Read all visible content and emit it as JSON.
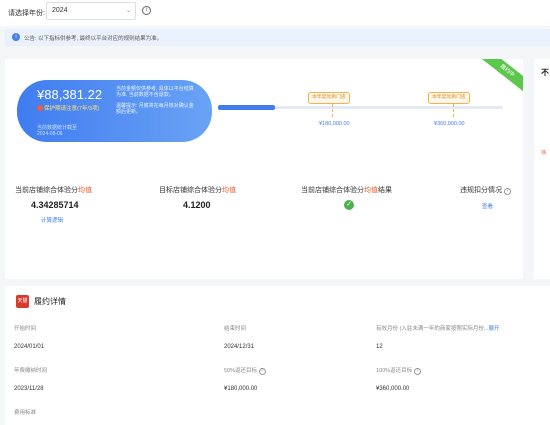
{
  "year_filter": {
    "label": "请选择年份:",
    "selected": "2024"
  },
  "notice": {
    "text": "公告: 以下指标供参考, 最终以平台对应的规则结果为准。"
  },
  "summary_card": {
    "amount": "¥88,381.22",
    "warning": "保护期请注意(7年/3项)",
    "stat_time_label": "当前数据统计截至",
    "stat_time": "2024-08-06",
    "note1": "当前金额仅供参考, 具体以平台结算为准, 当前数据不含退款。",
    "note2": "温馨提示: 月底将在每月核对确认金额后更新。"
  },
  "badge": {
    "label": "履约中"
  },
  "progress": {
    "fraction": 0.2,
    "milestones": [
      {
        "tag": "本年度优质门店",
        "value": "¥180,000.00"
      },
      {
        "tag": "本年度优质门店",
        "value": "¥360,000.00"
      }
    ]
  },
  "metrics": [
    {
      "title_prefix": "当前店铺综合体验分",
      "title_hl": "均值",
      "value": "4.34285714",
      "link": "计算逻辑"
    },
    {
      "title_prefix": "目标店铺综合体验分",
      "title_hl": "均值",
      "value": "4.1200"
    },
    {
      "title_prefix": "当前店铺综合体验分",
      "title_hl": "均值",
      "title_suffix": "结果",
      "status": "pass"
    },
    {
      "title_prefix": "违规扣分情况",
      "link": "查看"
    }
  ],
  "side_panel": {
    "title": "不",
    "red_text": "违"
  },
  "detail": {
    "icon_label": "天猫",
    "title": "履约详情",
    "fields": [
      {
        "label": "开始时间",
        "value": "2024/01/01"
      },
      {
        "label": "结束时间",
        "value": "2024/12/31"
      },
      {
        "label": "有效月份 (入驻未满一年的商家按照实际月份...",
        "label_link": "展开",
        "value": "12"
      },
      {
        "label": "年费缴纳时间",
        "value": "2023/11/28"
      },
      {
        "label": "50%返还目标",
        "value": "¥180,000.00"
      },
      {
        "label": "100%返还目标",
        "value": "¥360,000.00"
      },
      {
        "label": "费用标准"
      }
    ]
  },
  "colors": {
    "accent": "#3f7cf0",
    "success": "#4cb051",
    "warning": "#e45a28",
    "badge": "#5cc64d"
  }
}
